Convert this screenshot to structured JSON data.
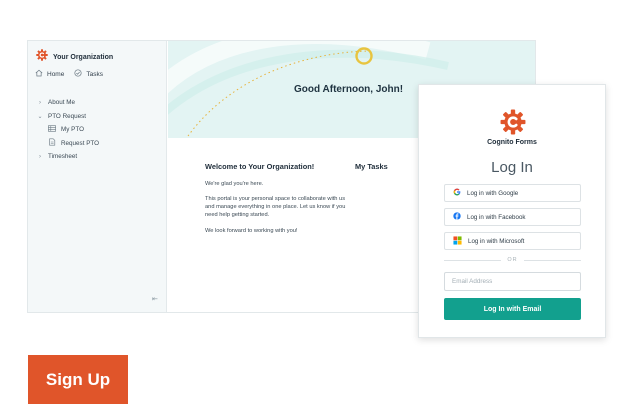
{
  "colors": {
    "accent_teal": "#12a08e",
    "brand_orange": "#e0552a",
    "hero_bg": "#e3f4f3",
    "sidebar_bg": "#f4f8f9"
  },
  "portal": {
    "org_name": "Your Organization",
    "nav_top": [
      {
        "label": "Home",
        "icon": "home-icon"
      },
      {
        "label": "Tasks",
        "icon": "check-circle-icon"
      }
    ],
    "tree": [
      {
        "label": "About Me",
        "icon": "chevron-right-icon"
      },
      {
        "label": "PTO Request",
        "icon": "chevron-down-icon"
      },
      {
        "label": "My PTO",
        "icon": "table-icon"
      },
      {
        "label": "Request PTO",
        "icon": "form-icon"
      },
      {
        "label": "Timesheet",
        "icon": "chevron-right-icon"
      }
    ],
    "collapse_icon": "collapse-sidebar-icon",
    "greeting": "Good Afternoon, John!",
    "welcome_title": "Welcome to Your Organization!",
    "tasks_title": "My Tasks",
    "paragraphs": [
      "We're glad you're here.",
      "This portal is your personal space to collaborate with us and manage everything in one place. Let us know if you need help getting started.",
      "We look forward to working with you!"
    ]
  },
  "login": {
    "brand": "Cognito Forms",
    "title": "Log In",
    "google": "Log in with Google",
    "facebook": "Log in with Facebook",
    "microsoft": "Log in with Microsoft",
    "or": "OR",
    "email_placeholder": "Email Address",
    "email_value": "",
    "email_button": "Log In with Email"
  },
  "signup_label": "Sign Up"
}
